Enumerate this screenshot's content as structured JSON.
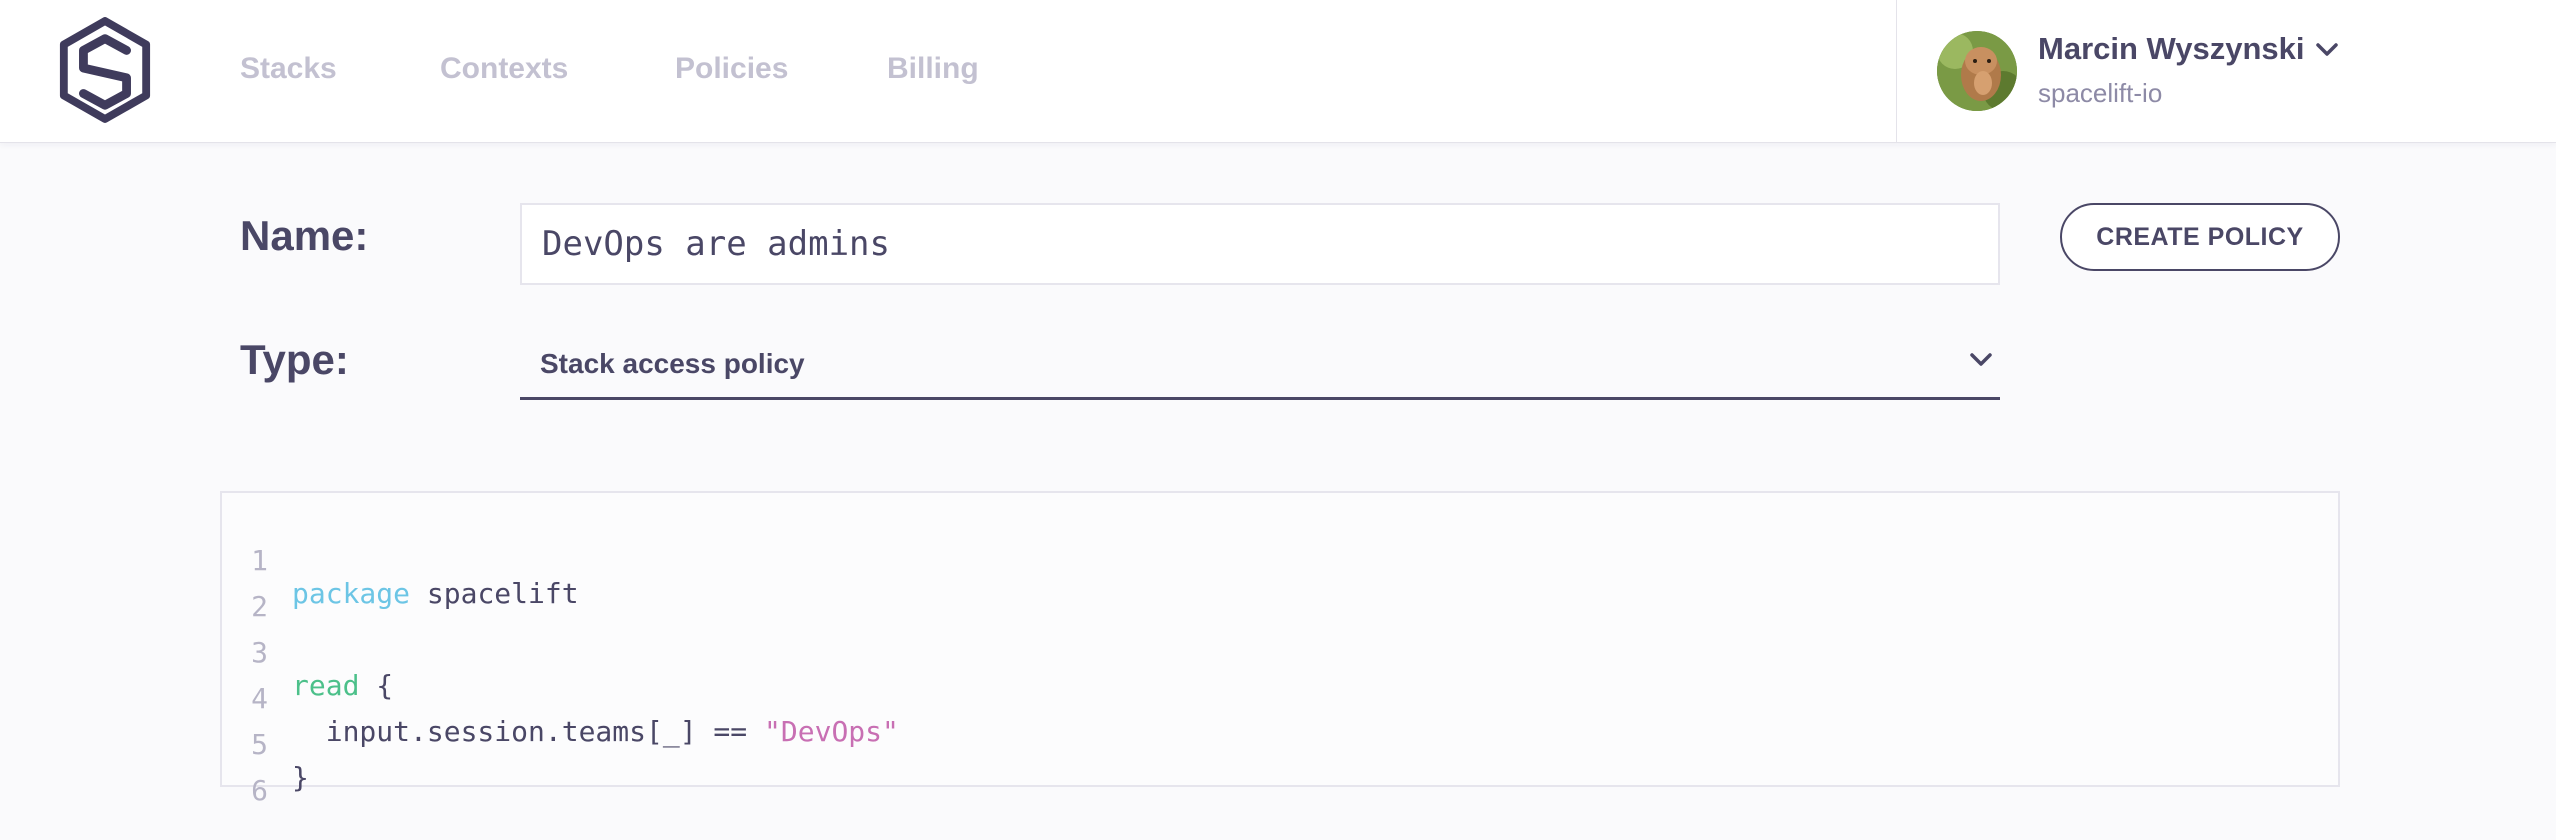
{
  "nav": {
    "links": [
      "Stacks",
      "Contexts",
      "Policies",
      "Billing"
    ]
  },
  "user": {
    "name": "Marcin Wyszynski",
    "org": "spacelift-io"
  },
  "form": {
    "name_label": "Name:",
    "name_value": "DevOps are admins",
    "type_label": "Type:",
    "type_value": "Stack access policy",
    "create_label": "CREATE POLICY"
  },
  "editor": {
    "line_numbers": [
      "1",
      "2",
      "3",
      "4",
      "5",
      "6"
    ],
    "tokens": {
      "l1_keyword": "package",
      "l1_rest": " spacelift",
      "l3_keyword": "read",
      "l3_rest": " {",
      "l4_code": "  input.session.teams[_] == ",
      "l4_string": "\"DevOps\"",
      "l5_code": "}"
    }
  },
  "colors": {
    "text": "#4a4766",
    "nav_link": "#c3c1d1",
    "keyword_package": "#6cc5e5",
    "keyword_rule": "#4cc08a",
    "string": "#c86fb3"
  },
  "icons": [
    "spacelift-logo-icon",
    "user-avatar",
    "chevron-down-icon"
  ]
}
